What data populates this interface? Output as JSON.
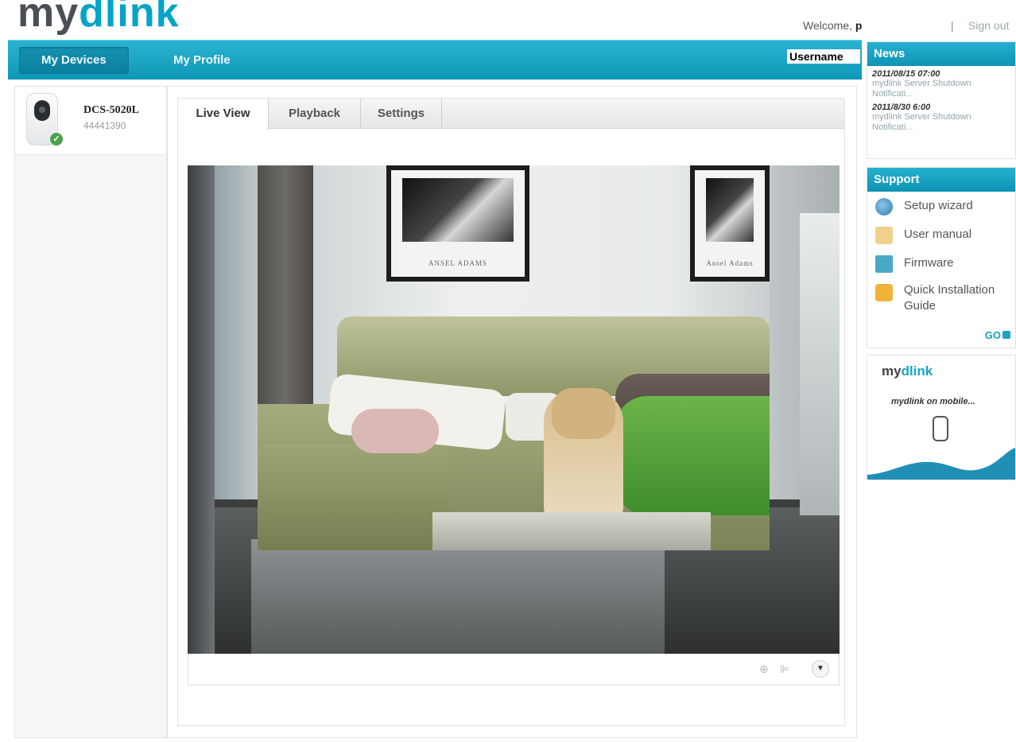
{
  "header": {
    "logo_my": "my",
    "logo_dlink": "dlink",
    "welcome_prefix": "Welcome,",
    "welcome_user": "p",
    "separator": "|",
    "signout": "Sign out"
  },
  "nav": {
    "tabs": [
      {
        "label": "My Devices",
        "active": true
      },
      {
        "label": "My Profile",
        "active": false
      }
    ],
    "username_label": "Username"
  },
  "devices": [
    {
      "model": "DCS-5020L",
      "id": "44441390",
      "status_icon": "check-icon"
    }
  ],
  "device_tabs": [
    {
      "label": "Live View",
      "active": true
    },
    {
      "label": "Playback",
      "active": false
    },
    {
      "label": "Settings",
      "active": false
    }
  ],
  "video": {
    "frame_caption_left": "ANSEL ADAMS",
    "frame_caption_right": "Ansel Adams",
    "controls": [
      "zoom-icon",
      "audio-icon",
      "expand-down-icon"
    ]
  },
  "news": {
    "title": "News",
    "items": [
      {
        "date": "2011/08/15 07:00",
        "text": "mydlink Server Shutdown Notificati..."
      },
      {
        "date": "2011/8/30 6:00",
        "text": "mydlink Server Shutdown Notificati..."
      }
    ]
  },
  "support": {
    "title": "Support",
    "items": [
      {
        "label": "Setup wizard",
        "icon": "wizard-icon"
      },
      {
        "label": "User manual",
        "icon": "manual-icon"
      },
      {
        "label": "Firmware",
        "icon": "firmware-icon"
      },
      {
        "label": "Quick Installation Guide",
        "icon": "guide-icon"
      }
    ],
    "go_label": "GO"
  },
  "promo": {
    "logo_my": "my",
    "logo_dlink": "dlink",
    "text": "mydlink on mobile..."
  },
  "colors": {
    "brand_teal": "#1aa3c3",
    "brand_gray": "#4a4f55"
  }
}
